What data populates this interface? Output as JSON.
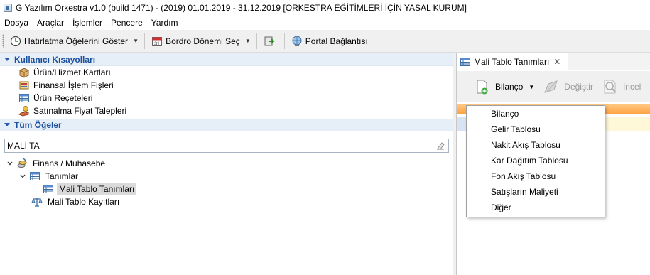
{
  "window": {
    "title": "G Yazılım Orkestra v1.0 (build 1471) - (2019) 01.01.2019 - 31.12.2019 [ORKESTRA EĞİTİMLERİ İÇİN YASAL KURUM]"
  },
  "menubar": {
    "items": [
      "Dosya",
      "Araçlar",
      "İşlemler",
      "Pencere",
      "Yardım"
    ]
  },
  "toolbar": {
    "reminder_label": "Hatırlatma Öğelerini Göster",
    "payroll_label": "Bordro Dönemi Seç",
    "portal_label": "Portal Bağlantısı"
  },
  "left": {
    "shortcuts_header": "Kullanıcı Kısayolları",
    "shortcuts": [
      {
        "label": "Ürün/Hizmet Kartları",
        "icon": "box-icon"
      },
      {
        "label": "Finansal İşlem Fişleri",
        "icon": "document-stack-icon"
      },
      {
        "label": "Ürün Reçeteleri",
        "icon": "table-icon"
      },
      {
        "label": "Satınalma Fiyat Talepleri",
        "icon": "hand-coins-icon"
      }
    ],
    "all_items_header": "Tüm Öğeler",
    "search_value": "MALİ TA",
    "tree": [
      {
        "label": "Finans / Muhasebe",
        "level": 0,
        "expanded": true
      },
      {
        "label": "Tanımlar",
        "level": 1,
        "expanded": true
      },
      {
        "label": "Mali Tablo Tanımları",
        "level": 2,
        "selected": true
      },
      {
        "label": "Mali Tablo Kayıtları",
        "level": 1
      }
    ]
  },
  "right": {
    "tab_label": "Mali Tablo Tanımları",
    "toolbar": {
      "bilanco_label": "Bilanço",
      "degistir_label": "Değiştir",
      "incele_label": "İncel"
    },
    "dropdown_items": [
      "Bilanço",
      "Gelir Tablosu",
      "Nakit Akış Tablosu",
      "Kar Dağıtım Tablosu",
      "Fon Akış Tablosu",
      "Satışların Maliyeti",
      "Diğer"
    ]
  }
}
